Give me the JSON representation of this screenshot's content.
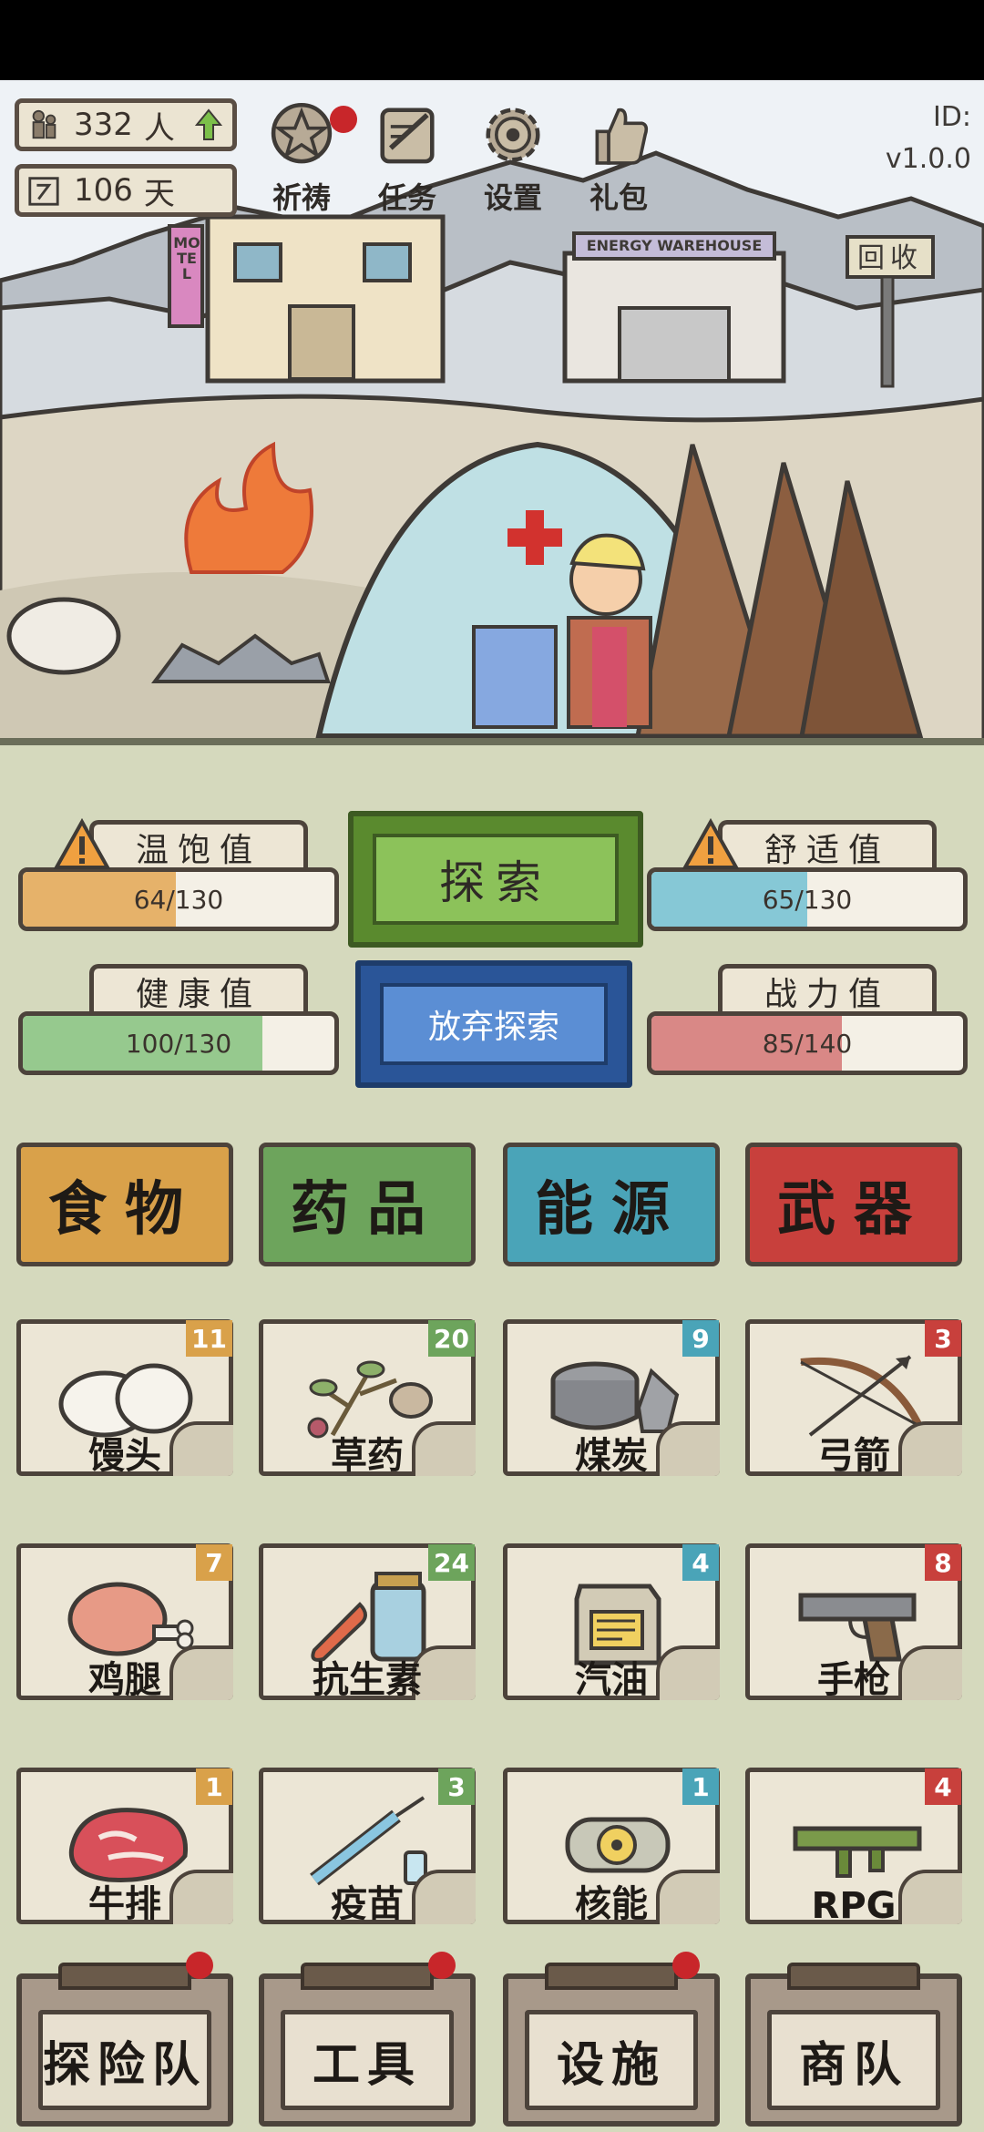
{
  "hud": {
    "population_value": "332",
    "population_unit": "人",
    "days_value": "106",
    "days_unit": "天"
  },
  "top_buttons": [
    {
      "label": "祈祷",
      "has_dot": true
    },
    {
      "label": "任务",
      "has_dot": false
    },
    {
      "label": "设置",
      "has_dot": false
    },
    {
      "label": "礼包",
      "has_dot": false
    }
  ],
  "version": {
    "id_label": "ID:",
    "version_text": "v1.0.0"
  },
  "scene": {
    "motel_sign": "MOTEL",
    "warehouse_sign": "ENERGY WAREHOUSE",
    "recycle_sign": "回收"
  },
  "stats": {
    "satiety": {
      "label": "温饱值",
      "current": 64,
      "max": 130,
      "text": "64/130",
      "color": "#e6b26a",
      "warning": true
    },
    "comfort": {
      "label": "舒适值",
      "current": 65,
      "max": 130,
      "text": "65/130",
      "color": "#86c8d6",
      "warning": true
    },
    "health": {
      "label": "健康值",
      "current": 100,
      "max": 130,
      "text": "100/130",
      "color": "#96c98e",
      "warning": false
    },
    "combat": {
      "label": "战力值",
      "current": 85,
      "max": 140,
      "text": "85/140",
      "color": "#d98886",
      "warning": false
    }
  },
  "actions": {
    "explore": "探索",
    "quit_explore": "放弃探索"
  },
  "categories": [
    {
      "label": "食物",
      "color": "#d9a14a"
    },
    {
      "label": "药品",
      "color": "#6da45c"
    },
    {
      "label": "能源",
      "color": "#4aa4b8"
    },
    {
      "label": "武器",
      "color": "#c8403c"
    }
  ],
  "items": [
    {
      "name": "馒头",
      "count": "11",
      "badge_color": "#d9a14a",
      "icon": "steamed-bun-icon"
    },
    {
      "name": "草药",
      "count": "20",
      "badge_color": "#6da45c",
      "icon": "herb-icon"
    },
    {
      "name": "煤炭",
      "count": "9",
      "badge_color": "#4aa4b8",
      "icon": "coal-icon"
    },
    {
      "name": "弓箭",
      "count": "3",
      "badge_color": "#c8403c",
      "icon": "bow-arrow-icon"
    },
    {
      "name": "鸡腿",
      "count": "7",
      "badge_color": "#d9a14a",
      "icon": "chicken-leg-icon"
    },
    {
      "name": "抗生素",
      "count": "24",
      "badge_color": "#6da45c",
      "icon": "antibiotic-icon"
    },
    {
      "name": "汽油",
      "count": "4",
      "badge_color": "#4aa4b8",
      "icon": "gasoline-can-icon"
    },
    {
      "name": "手枪",
      "count": "8",
      "badge_color": "#c8403c",
      "icon": "pistol-icon"
    },
    {
      "name": "牛排",
      "count": "1",
      "badge_color": "#d9a14a",
      "icon": "steak-icon"
    },
    {
      "name": "疫苗",
      "count": "3",
      "badge_color": "#6da45c",
      "icon": "vaccine-syringe-icon"
    },
    {
      "name": "核能",
      "count": "1",
      "badge_color": "#4aa4b8",
      "icon": "nuclear-cell-icon"
    },
    {
      "name": "RPG",
      "count": "4",
      "badge_color": "#c8403c",
      "icon": "rpg-launcher-icon"
    }
  ],
  "bottom_nav": [
    {
      "label": "探险队",
      "has_dot": true
    },
    {
      "label": "工具",
      "has_dot": true
    },
    {
      "label": "设施",
      "has_dot": true
    },
    {
      "label": "商队",
      "has_dot": false
    }
  ]
}
